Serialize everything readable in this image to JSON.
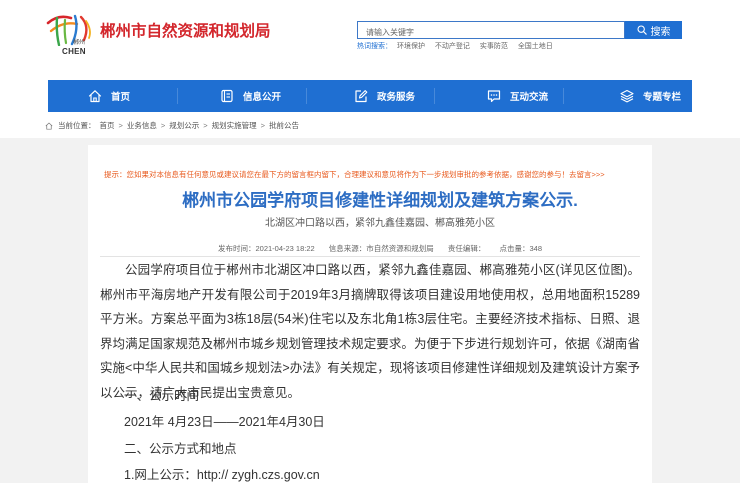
{
  "header": {
    "logo": {
      "icon": "city-logo-icon",
      "text": "郴州",
      "latin": "CHEN"
    },
    "site_title": "郴州市自然资源和规划局",
    "search": {
      "placeholder": "请输入关键字",
      "button_label": "搜索",
      "button_icon": "search-icon"
    },
    "hot_words_label": "热词搜索：",
    "hot_words": [
      "环境保护",
      "不动产登记",
      "实事防范",
      "全国土地日"
    ]
  },
  "nav": {
    "items": [
      {
        "label": "首页",
        "icon": "home-icon"
      },
      {
        "label": "信息公开",
        "icon": "document-icon"
      },
      {
        "label": "政务服务",
        "icon": "edit-icon"
      },
      {
        "label": "互动交流",
        "icon": "chat-icon"
      },
      {
        "label": "专题专栏",
        "icon": "layers-icon"
      }
    ]
  },
  "breadcrumb": {
    "icon": "home-icon",
    "label": "当前位置：",
    "separator": ">",
    "items": [
      "首页",
      "业务信息",
      "规划公示",
      "规划实施管理",
      "批前公告"
    ]
  },
  "article": {
    "notice": "提示：您如果对本信息有任何意见或建议请您在最下方的留言框内留下，合理建议和意见将作为下一步规划审批的参考依据，感谢您的参与！",
    "notice_link": "去留言>>>",
    "title": "郴州市公园学府项目修建性详细规划及建筑方案公示.",
    "subtitle": "北湖区冲口路以西，紧邻九鑫佳嘉园、郴高雅苑小区",
    "meta": {
      "publish_label": "发布时间：",
      "publish_time": "2021-04-23 18:22",
      "source_label": "信息来源：",
      "source": "市自然资源和规划局",
      "editor_label": "责任编辑：",
      "views_label": "点击量：",
      "views": "348"
    },
    "intro": "公园学府项目位于郴州市北湖区冲口路以西，紧邻九鑫佳嘉园、郴高雅苑小区(详见区位图)。郴州市平海房地产开发有限公司于2019年3月摘牌取得该项目建设用地使用权，总用地面积15289平方米。方案总平面为3栋18层(54米)住宅以及东北角1栋3层住宅。主要经济技术指标、日照、退界均满足国家规范及郴州市城乡规划管理技术规定要求。为便于下步进行规划许可，依据《湖南省实施<中华人民共和国城乡规划法>办法》有关规定，现将该项目修建性详细规划及建筑设计方案予以公示，请广大市民提出宝贵意见。",
    "sections": [
      {
        "heading": "一、公示时间",
        "items": [
          "2021年 4月23日——2021年4月30日"
        ]
      },
      {
        "heading": "二、公示方式和地点",
        "items": [
          "1.网上公示：http:// zygh.czs.gov.cn"
        ]
      }
    ]
  },
  "colors": {
    "brand_red": "#d3262c",
    "nav_blue": "#1f6fd2",
    "title_blue": "#2d6dc3",
    "notice": "#e85a1e"
  }
}
